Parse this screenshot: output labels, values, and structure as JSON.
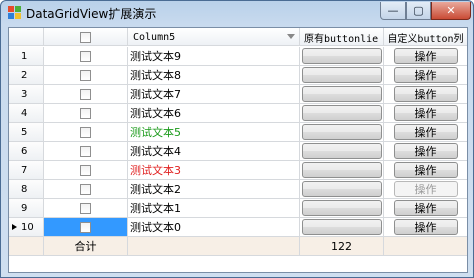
{
  "window": {
    "title": "DataGridView扩展演示",
    "min_glyph": "—",
    "max_glyph": "▢",
    "close_glyph": "✕"
  },
  "grid": {
    "columns": {
      "column5": "Column5",
      "button_col": "原有buttonlie",
      "custom_button_col": "自定义button列"
    },
    "rows": [
      {
        "num": "1",
        "text": "测试文本9",
        "color": "#000000",
        "op": "操作",
        "op_disabled": false
      },
      {
        "num": "2",
        "text": "测试文本8",
        "color": "#000000",
        "op": "操作",
        "op_disabled": false
      },
      {
        "num": "3",
        "text": "测试文本7",
        "color": "#000000",
        "op": "操作",
        "op_disabled": false
      },
      {
        "num": "4",
        "text": "测试文本6",
        "color": "#000000",
        "op": "操作",
        "op_disabled": false
      },
      {
        "num": "5",
        "text": "测试文本5",
        "color": "#1a9a1a",
        "op": "操作",
        "op_disabled": false
      },
      {
        "num": "6",
        "text": "测试文本4",
        "color": "#000000",
        "op": "操作",
        "op_disabled": false
      },
      {
        "num": "7",
        "text": "测试文本3",
        "color": "#e02020",
        "op": "操作",
        "op_disabled": false
      },
      {
        "num": "8",
        "text": "测试文本2",
        "color": "#000000",
        "op": "操作",
        "op_disabled": true
      },
      {
        "num": "9",
        "text": "测试文本1",
        "color": "#000000",
        "op": "操作",
        "op_disabled": false
      },
      {
        "num": "10",
        "text": "测试文本0",
        "color": "#000000",
        "op": "操作",
        "op_disabled": false,
        "current": true,
        "selected_checkbox_cell": true
      }
    ],
    "footer": {
      "label": "合计",
      "total": "122"
    }
  }
}
